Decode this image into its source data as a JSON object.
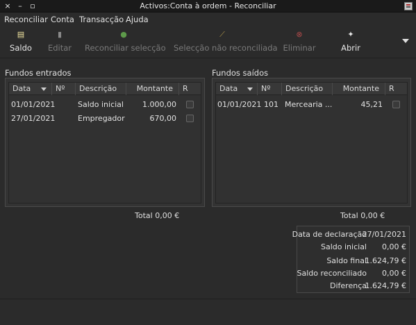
{
  "window": {
    "title": "Activos:Conta à ordem - Reconciliar",
    "close_glyph": "×",
    "minimize_glyph": "–",
    "maximize_glyph": "▫"
  },
  "menu": [
    "Reconciliar",
    "Conta",
    "Transacção",
    "Ajuda"
  ],
  "toolbar": {
    "buttons": [
      {
        "label": "Saldo",
        "icon": "balance-icon",
        "enabled": true
      },
      {
        "label": "Editar",
        "icon": "edit-icon",
        "enabled": false
      },
      {
        "label": "Reconciliar selecção",
        "icon": "reconcile-icon",
        "enabled": false
      },
      {
        "label": "Selecção não reconciliada",
        "icon": "unreconcile-icon",
        "enabled": false
      },
      {
        "label": "Eliminar",
        "icon": "delete-icon",
        "enabled": false
      },
      {
        "label": "Abrir",
        "icon": "open-icon",
        "enabled": true
      }
    ]
  },
  "funds_in": {
    "title": "Fundos entrados",
    "columns": [
      "Data",
      "Nº",
      "Descrição",
      "Montante",
      "R"
    ],
    "rows": [
      {
        "date": "01/01/2021",
        "num": "",
        "description": "Saldo inicial",
        "amount": "1.000,00",
        "reconciled": false
      },
      {
        "date": "27/01/2021",
        "num": "",
        "description": "Empregador",
        "amount": "670,00",
        "reconciled": false
      }
    ],
    "total_label": "Total",
    "total_value": "0,00 €"
  },
  "funds_out": {
    "title": "Fundos saídos",
    "columns": [
      "Data",
      "Nº",
      "Descrição",
      "Montante",
      "R"
    ],
    "rows": [
      {
        "date": "01/01/2021",
        "num": "101",
        "description": "Mercearia ...",
        "amount": "45,21",
        "reconciled": false
      }
    ],
    "total_label": "Total",
    "total_value": "0,00 €"
  },
  "summary": [
    {
      "label": "Data de declaração",
      "value": "27/01/2021"
    },
    {
      "label": "Saldo inicial",
      "value": "0,00 €"
    },
    {
      "label": "Saldo final",
      "value": "1.624,79 €"
    },
    {
      "label": "Saldo reconciliado",
      "value": "0,00 €"
    },
    {
      "label": "Diferença",
      "value": "1.624,79 €"
    }
  ]
}
